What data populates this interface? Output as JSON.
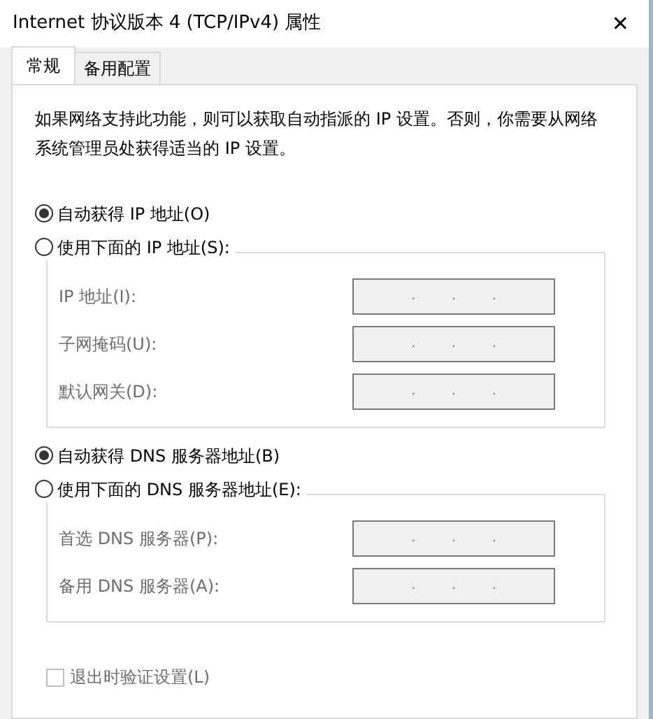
{
  "window": {
    "title": "Internet 协议版本 4 (TCP/IPv4) 属性",
    "close": "✕"
  },
  "tabs": [
    {
      "label": "常规",
      "selected": true
    },
    {
      "label": "备用配置",
      "selected": false
    }
  ],
  "intro": "如果网络支持此功能，则可以获取自动指派的 IP 设置。否则，你需要从网络系统管理员处获得适当的 IP 设置。",
  "sections": [
    {
      "auto_option": {
        "label": "自动获得 IP 地址(O)",
        "selected": true
      },
      "manual_option": {
        "label": "使用下面的 IP 地址(S):",
        "selected": false
      },
      "fields": [
        {
          "label": "IP 地址(I):",
          "separators": [
            ".",
            ".",
            "."
          ],
          "disabled": true
        },
        {
          "label": "子网掩码(U):",
          "separators": [
            ".",
            ".",
            "."
          ],
          "disabled": true
        },
        {
          "label": "默认网关(D):",
          "separators": [
            ".",
            ".",
            "."
          ],
          "disabled": true
        }
      ]
    },
    {
      "auto_option": {
        "label": "自动获得 DNS 服务器地址(B)",
        "selected": true
      },
      "manual_option": {
        "label": "使用下面的 DNS 服务器地址(E):",
        "selected": false
      },
      "fields": [
        {
          "label": "首选 DNS 服务器(P):",
          "separators": [
            ".",
            ".",
            "."
          ],
          "disabled": true
        },
        {
          "label": "备用 DNS 服务器(A):",
          "separators": [
            ".",
            ".",
            "."
          ],
          "disabled": true
        }
      ]
    }
  ],
  "validate_checkbox": {
    "label": "退出时验证设置(L)",
    "checked": false,
    "disabled": true
  }
}
